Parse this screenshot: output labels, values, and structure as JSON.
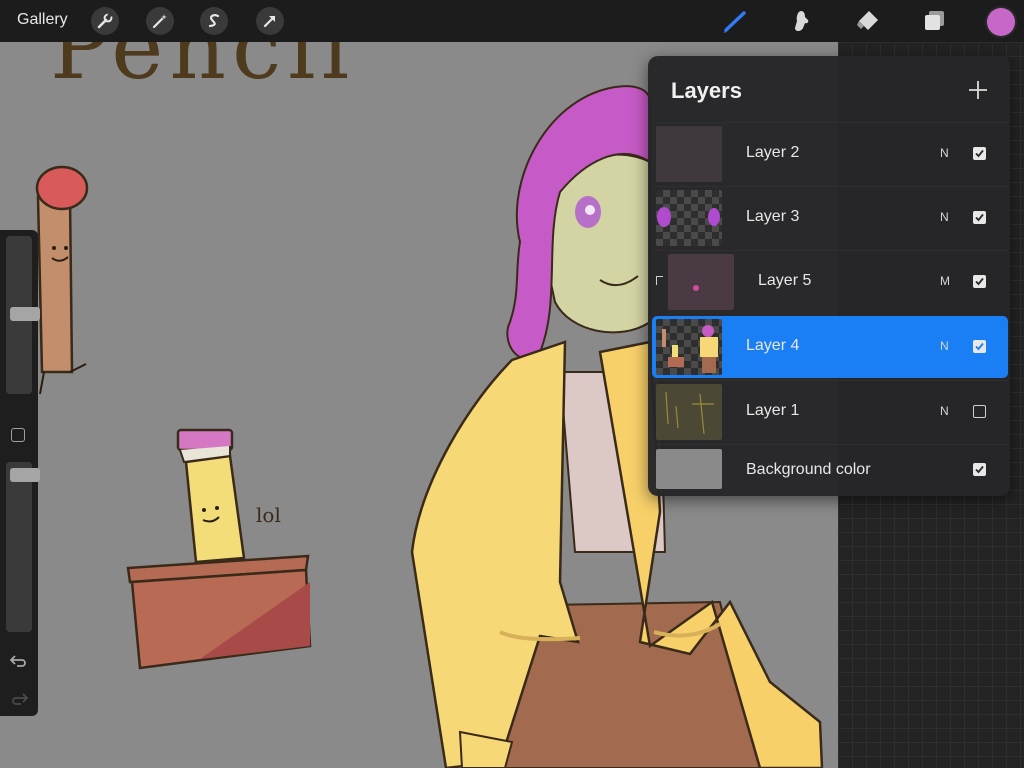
{
  "toolbar": {
    "gallery_label": "Gallery",
    "left_tools": [
      "wrench-icon",
      "magic-wand-icon",
      "selection-s-icon",
      "move-arrow-icon"
    ],
    "right_tools": [
      "brush-icon",
      "smudge-icon",
      "eraser-icon",
      "layers-icon"
    ],
    "active_tool_color": "#2f7df6",
    "current_color": "#c768c8"
  },
  "sidebar": {
    "brush_size_level": 0.51,
    "opacity_level": 0.96,
    "tools": [
      "modify-square-icon",
      "undo-icon",
      "redo-icon"
    ]
  },
  "canvas": {
    "background_color": "#8a8a8a",
    "title_text": "Pencil",
    "annotation_text": "lol"
  },
  "layers_panel": {
    "title": "Layers",
    "add_icon": "plus-icon",
    "layers": [
      {
        "name": "Layer 2",
        "blend": "N",
        "visible": true,
        "active": false,
        "clipped": false
      },
      {
        "name": "Layer 3",
        "blend": "N",
        "visible": true,
        "active": false,
        "clipped": false
      },
      {
        "name": "Layer 5",
        "blend": "M",
        "visible": true,
        "active": false,
        "clipped": true
      },
      {
        "name": "Layer 4",
        "blend": "N",
        "visible": true,
        "active": true,
        "clipped": false
      },
      {
        "name": "Layer 1",
        "blend": "N",
        "visible": false,
        "active": false,
        "clipped": false
      },
      {
        "name": "Background color",
        "blend": "",
        "visible": true,
        "active": false,
        "clipped": false
      }
    ]
  }
}
